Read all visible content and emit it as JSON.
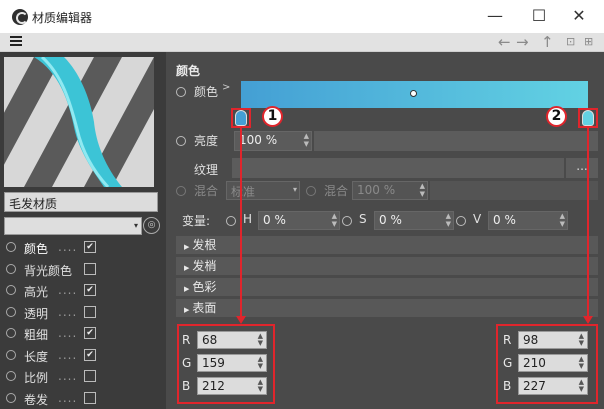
{
  "window": {
    "title": "材质编辑器",
    "minimize": "—",
    "maximize": "☐",
    "close": "✕"
  },
  "toolbar": {
    "back": "←",
    "forward": "→",
    "up": "↑",
    "lock": "🔒",
    "new": "⊞"
  },
  "left": {
    "material_name": "毛发材质",
    "channels": [
      {
        "label": "颜色",
        "dots": "....",
        "checked": true,
        "active": true
      },
      {
        "label": "背光颜色",
        "dots": "",
        "checked": false,
        "active": false
      },
      {
        "label": "高光",
        "dots": "....",
        "checked": true,
        "active": false
      },
      {
        "label": "透明",
        "dots": "....",
        "checked": false,
        "active": false
      },
      {
        "label": "粗细",
        "dots": "....",
        "checked": true,
        "active": false
      },
      {
        "label": "长度",
        "dots": "....",
        "checked": true,
        "active": false
      },
      {
        "label": "比例",
        "dots": "....",
        "checked": false,
        "active": false
      },
      {
        "label": "卷发",
        "dots": "....",
        "checked": false,
        "active": false
      }
    ]
  },
  "color_section": {
    "title": "颜色",
    "color_label": "颜色",
    "brightness_label": "亮度",
    "brightness_value": "100 %",
    "texture_label": "纹理",
    "texture_menu": "...",
    "blend_label": "混合",
    "blend_mode": "标准",
    "blend_label2": "混合",
    "blend_value": "100 %",
    "vary_label": "变量:",
    "h_label": "H",
    "h_value": "0 %",
    "s_label": "S",
    "s_value": "0 %",
    "v_label": "V",
    "v_value": "0 %",
    "gradient": {
      "left_color": "#449fd4",
      "right_color": "#62d2e3"
    }
  },
  "folds": [
    "发根",
    "发梢",
    "色彩",
    "表面"
  ],
  "left_knot": {
    "R": "68",
    "G": "159",
    "B": "212"
  },
  "right_knot": {
    "R": "98",
    "G": "210",
    "B": "227"
  },
  "callouts": {
    "one": "1",
    "two": "2"
  }
}
